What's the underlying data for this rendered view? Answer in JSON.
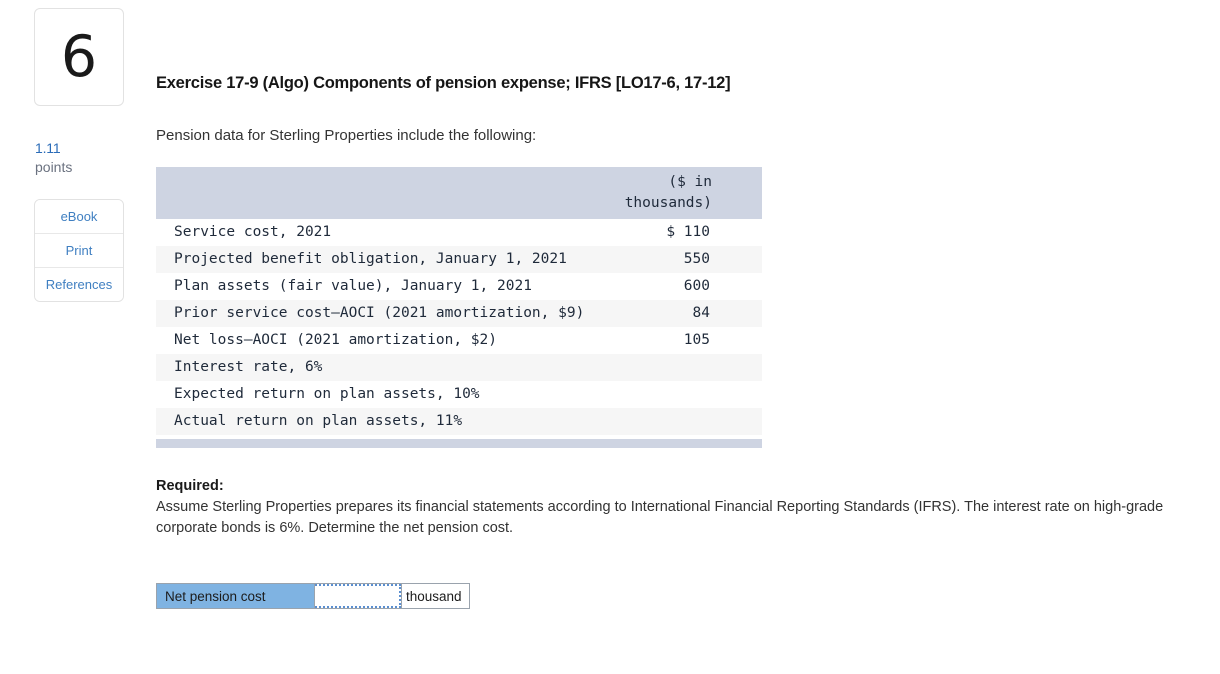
{
  "sidebar": {
    "question_number": "6",
    "points_value": "1.11",
    "points_label": "points",
    "tools": [
      {
        "label": "eBook",
        "name": "ebook-button"
      },
      {
        "label": "Print",
        "name": "print-button"
      },
      {
        "label": "References",
        "name": "references-button"
      }
    ]
  },
  "exercise": {
    "title": "Exercise 17-9 (Algo) Components of pension expense; IFRS [LO17-6, 17-12]",
    "intro": "Pension data for Sterling Properties include the following:"
  },
  "table": {
    "header_label": "",
    "header_value": "($ in thousands)",
    "rows": [
      {
        "label": "Service cost, 2021",
        "value": "$ 110"
      },
      {
        "label": "Projected benefit obligation, January 1, 2021",
        "value": "550"
      },
      {
        "label": "Plan assets (fair value), January 1, 2021",
        "value": "600"
      },
      {
        "label": "Prior service cost–AOCI (2021 amortization, $9)",
        "value": "84"
      },
      {
        "label": "Net loss–AOCI (2021 amortization, $2)",
        "value": "105"
      },
      {
        "label": "Interest rate, 6%",
        "value": ""
      },
      {
        "label": "Expected return on plan assets, 10%",
        "value": ""
      },
      {
        "label": "Actual return on plan assets, 11%",
        "value": ""
      }
    ]
  },
  "required": {
    "heading": "Required:",
    "body": "Assume Sterling Properties prepares its financial statements according to International Financial Reporting Standards (IFRS). The interest rate on high-grade corporate bonds is 6%. Determine the net pension cost."
  },
  "answer": {
    "label": "Net pension cost",
    "input_value": "",
    "input_placeholder": "",
    "unit": "thousand"
  },
  "colors": {
    "table_header_bg": "#ced4e2",
    "row_alt_bg": "#f6f6f6",
    "answer_label_bg": "#7fb3e2",
    "link_blue": "#3f7fc1",
    "points_blue": "#2b6cb8"
  }
}
